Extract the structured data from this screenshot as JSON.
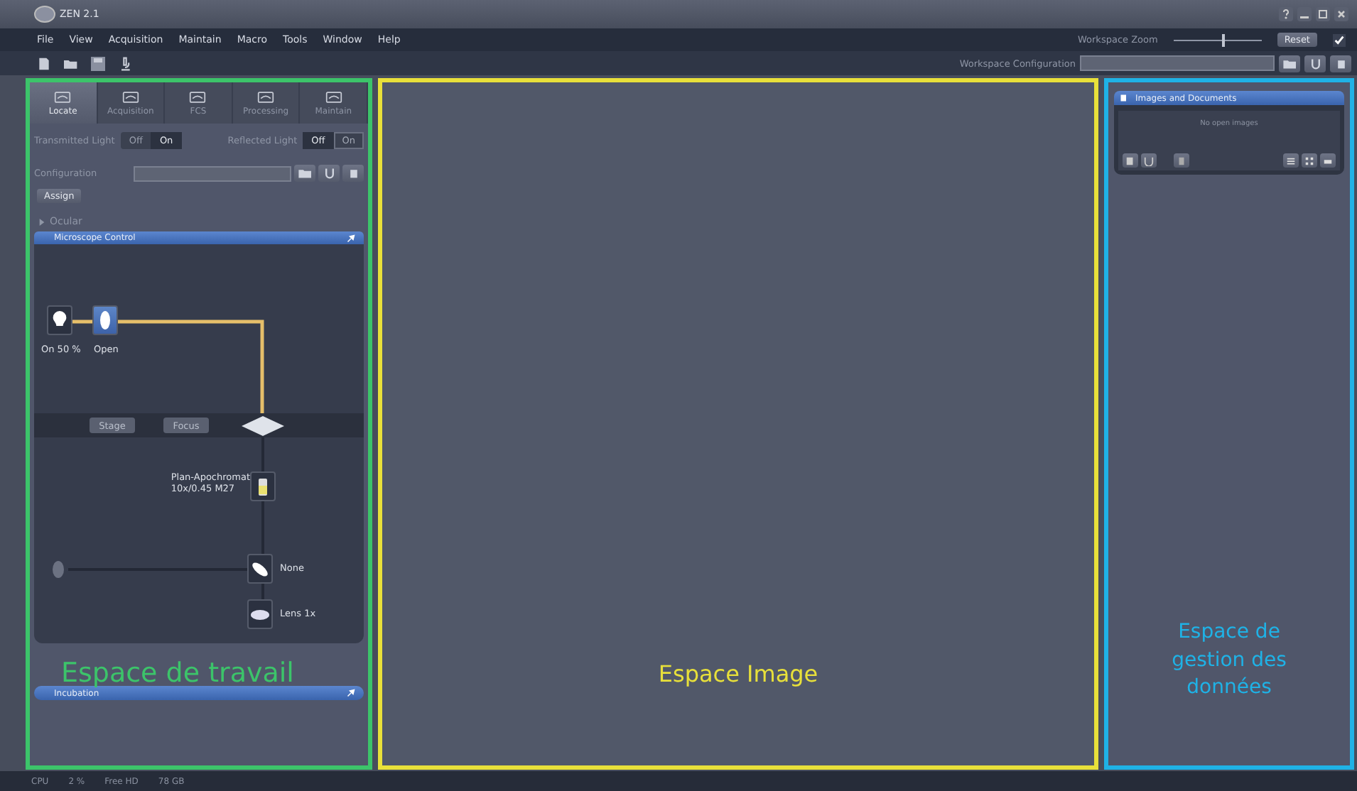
{
  "window": {
    "title": "ZEN 2.1"
  },
  "menu": [
    "File",
    "View",
    "Acquisition",
    "Maintain",
    "Macro",
    "Tools",
    "Window",
    "Help"
  ],
  "workspace_zoom": {
    "label": "Workspace Zoom",
    "level": 0.55,
    "reset": "Reset",
    "checked": true
  },
  "workspace_configuration": {
    "label": "Workspace Configuration"
  },
  "tool_tabs": [
    {
      "label": "Locate",
      "selected": true
    },
    {
      "label": "Acquisition",
      "selected": false
    },
    {
      "label": "FCS",
      "selected": false
    },
    {
      "label": "Processing",
      "selected": false
    },
    {
      "label": "Maintain",
      "selected": false
    }
  ],
  "lights": [
    {
      "label": "Transmitted Light",
      "options": [
        {
          "label": "Off",
          "selected": false,
          "disabled": false
        },
        {
          "label": "On",
          "selected": true,
          "disabled": false
        }
      ]
    },
    {
      "label": "Reflected Light",
      "options": [
        {
          "label": "Off",
          "selected": true,
          "disabled": false
        },
        {
          "label": "On",
          "selected": false,
          "disabled": true
        }
      ]
    }
  ],
  "configuration": {
    "label": "Configuration",
    "assign": "Assign"
  },
  "sections": [
    {
      "label": "Ocular",
      "expanded": false
    }
  ],
  "microscope_control": {
    "title": "Microscope Control",
    "lamp": "On 50 %",
    "shutter": "Open",
    "stage": "Stage",
    "focus": "Focus",
    "objective": [
      "Plan-Apochromat",
      "10x/0.45 M27"
    ],
    "reflector": "None",
    "lens": "Lens 1x"
  },
  "incubation": {
    "title": "Incubation"
  },
  "images_and_documents": {
    "title": "Images and Documents",
    "empty": "No open images"
  },
  "annotations": [
    {
      "text": "Espace de travail",
      "color": "#3cc46a"
    },
    {
      "text": "Espace Image",
      "color": "#e8e03a"
    },
    {
      "text": "Espace de gestion des données",
      "color": "#1fb2e6"
    }
  ],
  "status_bar": [
    "CPU",
    "2 %",
    "Free HD",
    "78 GB"
  ]
}
